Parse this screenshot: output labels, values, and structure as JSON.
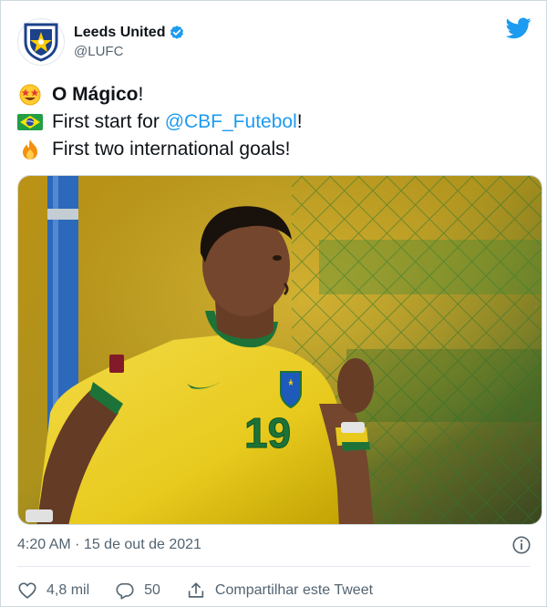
{
  "account": {
    "display_name": "Leeds United",
    "handle": "@LUFC",
    "verified": true
  },
  "brand_icon": "twitter-bird-icon",
  "colors": {
    "brand_blue": "#1d9bf0",
    "text_primary": "#0f1419",
    "text_secondary": "#536471"
  },
  "tweet": {
    "line1": {
      "emoji": "star-struck-emoji",
      "bold": "O Mágico",
      "tail": "!"
    },
    "line2": {
      "emoji": "brazil-flag-emoji",
      "prefix": "First start for ",
      "mention": "@CBF_Futebol",
      "tail": "!"
    },
    "line3": {
      "emoji": "fire-emoji",
      "text": "First two international goals!"
    }
  },
  "media": {
    "description_icon": "football-player-photo",
    "jersey_number": "19"
  },
  "timestamp": "4:20 AM · 15 de out de 2021",
  "info_icon": "info-icon",
  "actions": {
    "likes": "4,8 mil",
    "replies": "50",
    "share_label": "Compartilhar este Tweet"
  }
}
